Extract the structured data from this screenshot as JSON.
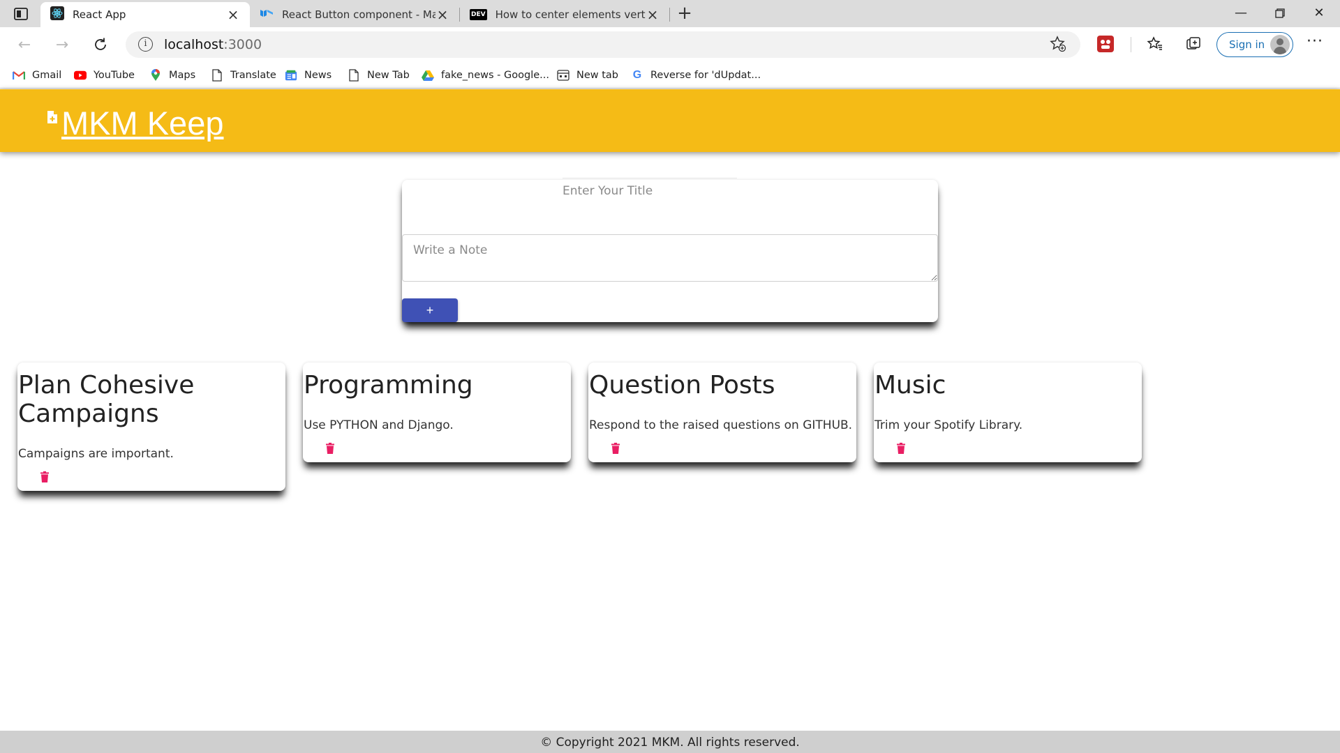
{
  "browser": {
    "tabs": [
      {
        "title": "React App",
        "active": true,
        "icon": "react-icon"
      },
      {
        "title": "React Button component - Mate",
        "active": false,
        "icon": "material-ui-icon"
      },
      {
        "title": "How to center elements verticall",
        "active": false,
        "icon": "dev-icon"
      }
    ],
    "url_host": "localhost",
    "url_port": ":3000",
    "signin_label": "Sign in",
    "dev_badge": "DEV",
    "bookmarks": [
      {
        "label": "Gmail",
        "icon": "gmail-icon"
      },
      {
        "label": "YouTube",
        "icon": "youtube-icon"
      },
      {
        "label": "Maps",
        "icon": "maps-icon"
      },
      {
        "label": "Translate",
        "icon": "page-icon"
      },
      {
        "label": "News",
        "icon": "news-icon"
      },
      {
        "label": "New Tab",
        "icon": "page-icon"
      },
      {
        "label": "fake_news - Google...",
        "icon": "drive-icon"
      },
      {
        "label": "New tab",
        "icon": "newtab-icon"
      },
      {
        "label": "Reverse for 'dUpdat...",
        "icon": "google-icon"
      }
    ]
  },
  "app": {
    "brand": "MKM Keep",
    "accent_color": "#f5bb16",
    "form": {
      "title_placeholder": "Enter Your Title",
      "note_placeholder": "Write a Note",
      "add_label": "+"
    },
    "notes": [
      {
        "title": "Plan Cohesive Campaigns",
        "body": "Campaigns are important."
      },
      {
        "title": "Programming",
        "body": "Use PYTHON and Django."
      },
      {
        "title": "Question Posts",
        "body": "Respond to the raised questions on GITHUB."
      },
      {
        "title": "Music",
        "body": "Trim your Spotify Library."
      }
    ],
    "delete_color": "#e91e63",
    "button_color": "#3f51b5",
    "footer": "© Copyright 2021 MKM. All rights reserved."
  }
}
